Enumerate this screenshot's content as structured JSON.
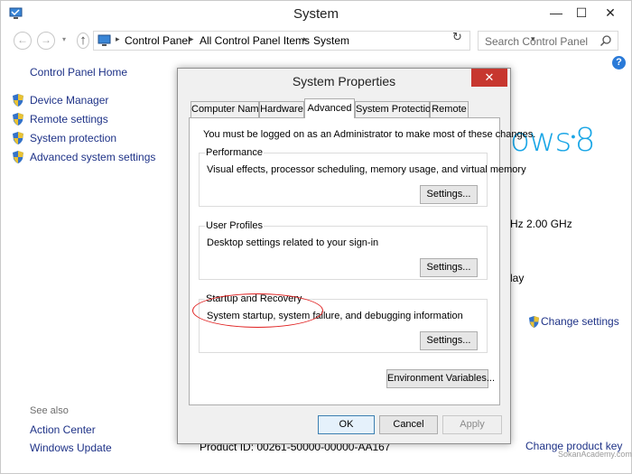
{
  "window": {
    "title": "System",
    "minimize_glyph": "—",
    "maximize_glyph": "☐",
    "close_glyph": "✕"
  },
  "nav": {
    "back_glyph": "←",
    "forward_glyph": "→",
    "recent_glyph": "▾",
    "up_glyph": "↑",
    "breadcrumbs": [
      "Control Panel",
      "All Control Panel Items",
      "System"
    ],
    "separator_glyph": "▸",
    "dropdown_glyph": "▾",
    "refresh_glyph": "↻",
    "search_placeholder": "Search Control Panel"
  },
  "sidebar": {
    "home": "Control Panel Home",
    "tasks": [
      {
        "label": "Device Manager",
        "icon": "shield-icon"
      },
      {
        "label": "Remote settings",
        "icon": "shield-icon"
      },
      {
        "label": "System protection",
        "icon": "shield-icon"
      },
      {
        "label": "Advanced system settings",
        "icon": "shield-icon"
      }
    ],
    "see_also": "See also",
    "links": [
      "Action Center",
      "Windows Update"
    ]
  },
  "background": {
    "logo_text": "ows",
    "logo_number": "8",
    "speed_text": "Hz   2.00 GHz",
    "type_text": "lay",
    "change_settings": "Change settings",
    "product_id": "Product ID: 00261-50000-00000-AA167",
    "change_key": "Change product key",
    "watermark": "SokanAcademy.com",
    "help_glyph": "?"
  },
  "dialog": {
    "title": "System Properties",
    "close_glyph": "✕",
    "tabs": [
      "Computer Name",
      "Hardware",
      "Advanced",
      "System Protection",
      "Remote"
    ],
    "active_tab": "Advanced",
    "admin_note": "You must be logged on as an Administrator to make most of these changes.",
    "groups": [
      {
        "label": "Performance",
        "desc": "Visual effects, processor scheduling, memory usage, and virtual memory",
        "button": "Settings..."
      },
      {
        "label": "User Profiles",
        "desc": "Desktop settings related to your sign-in",
        "button": "Settings..."
      },
      {
        "label": "Startup and Recovery",
        "desc": "System startup, system failure, and debugging information",
        "button": "Settings..."
      }
    ],
    "env_button": "Environment Variables...",
    "ok": "OK",
    "cancel": "Cancel",
    "apply": "Apply"
  },
  "colors": {
    "link": "#1e3287",
    "accent_blue": "#1aa6e6",
    "close_red": "#c7372f",
    "highlight_red": "#e02020"
  }
}
